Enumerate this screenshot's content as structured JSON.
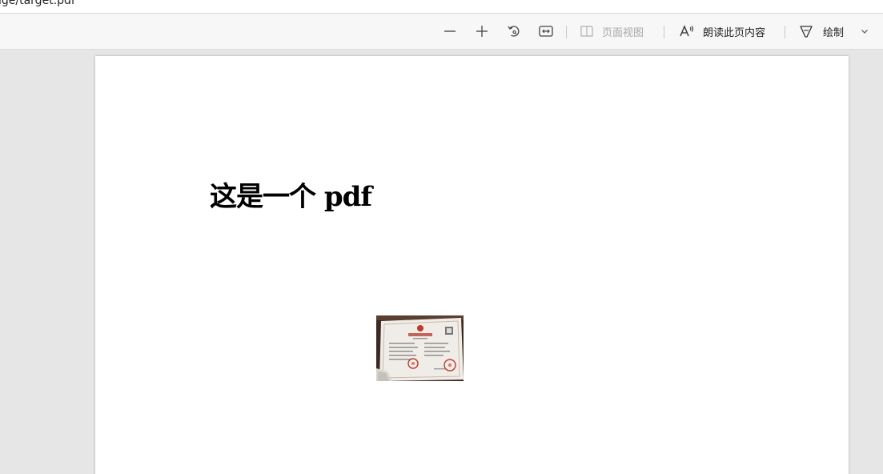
{
  "address": {
    "url_fragment": "ige/target.pdf"
  },
  "toolbar": {
    "zoom_out_icon": "minus-icon",
    "zoom_in_icon": "plus-icon",
    "rotate_icon": "rotate-icon",
    "fit_width_icon": "fit-width-icon",
    "page_view_icon": "page-view-icon",
    "page_view_label": "页面视图",
    "read_aloud_icon": "read-aloud-icon",
    "read_aloud_label": "朗读此页内容",
    "draw_icon": "draw-icon",
    "draw_label": "绘制",
    "draw_dropdown_icon": "chevron-down-icon"
  },
  "document": {
    "heading": "这是一个 pdf",
    "image_icon": "certificate-image"
  },
  "colors": {
    "toolbar_bg": "#f7f7f7",
    "viewer_bg": "#e6e6e6",
    "page_bg": "#ffffff",
    "disabled_text": "#a8a8a8"
  }
}
